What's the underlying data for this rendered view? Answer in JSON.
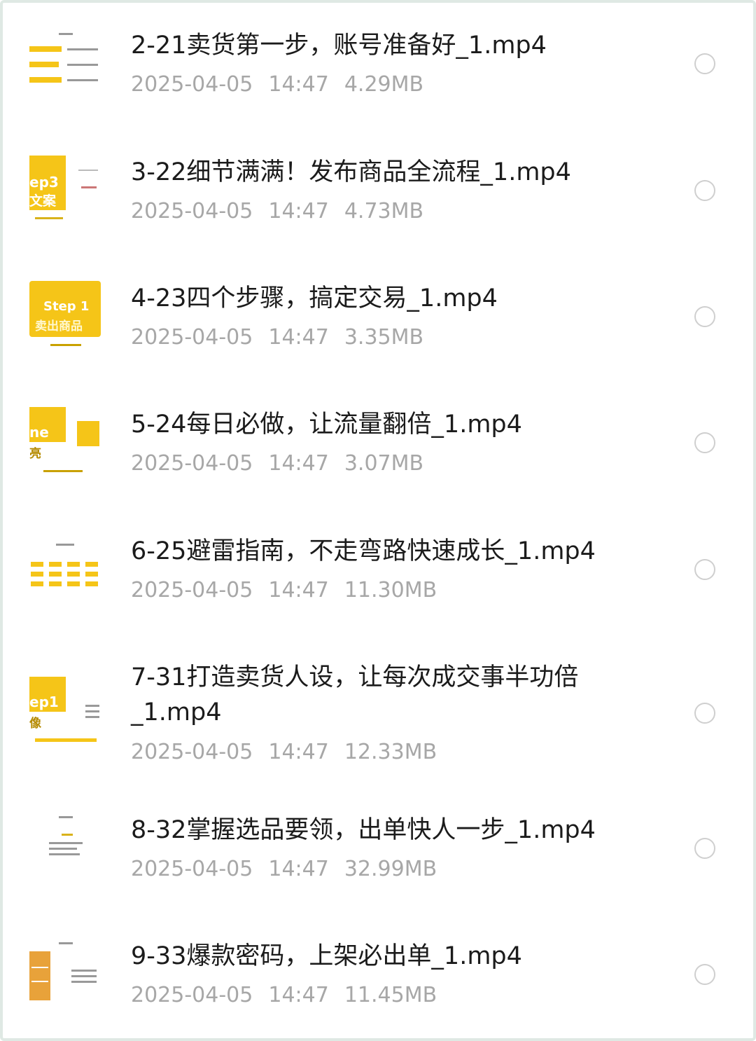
{
  "files": [
    {
      "title": "2-21卖货第一步，账号准备好_1.mp4",
      "date": "2025-04-05",
      "time": "14:47",
      "size": "4.29MB",
      "thumb_icon": "slide-thumbnail-account-setup"
    },
    {
      "title": "3-22细节满满！发布商品全流程_1.mp4",
      "date": "2025-04-05",
      "time": "14:47",
      "size": "4.73MB",
      "thumb_icon": "slide-thumbnail-step3",
      "thumb_text": [
        "ep3",
        "文案"
      ]
    },
    {
      "title": "4-23四个步骤，搞定交易_1.mp4",
      "date": "2025-04-05",
      "time": "14:47",
      "size": "3.35MB",
      "thumb_icon": "slide-thumbnail-step1-sell",
      "thumb_text": [
        "Step 1",
        "卖出商品"
      ]
    },
    {
      "title": "5-24每日必做，让流量翻倍_1.mp4",
      "date": "2025-04-05",
      "time": "14:47",
      "size": "3.07MB",
      "thumb_icon": "slide-thumbnail-daily",
      "thumb_text": [
        "ne",
        "亮"
      ]
    },
    {
      "title": "6-25避雷指南，不走弯路快速成长_1.mp4",
      "date": "2025-04-05",
      "time": "14:47",
      "size": "11.30MB",
      "thumb_icon": "slide-thumbnail-grid"
    },
    {
      "title": "7-31打造卖货人设，让每次成交事半功倍_1.mp4",
      "date": "2025-04-05",
      "time": "14:47",
      "size": "12.33MB",
      "thumb_icon": "slide-thumbnail-persona",
      "thumb_text": [
        "ep1",
        "像"
      ]
    },
    {
      "title": "8-32掌握选品要领，出单快人一步_1.mp4",
      "date": "2025-04-05",
      "time": "14:47",
      "size": "32.99MB",
      "thumb_icon": "slide-thumbnail-product-selection"
    },
    {
      "title": "9-33爆款密码，上架必出单_1.mp4",
      "date": "2025-04-05",
      "time": "14:47",
      "size": "11.45MB",
      "thumb_icon": "slide-thumbnail-hot-items"
    }
  ],
  "colors": {
    "title": "#1b1b1b",
    "meta": "#a7a7a7",
    "accent_yellow": "#f5c518",
    "frame": "#dfe9e4"
  }
}
